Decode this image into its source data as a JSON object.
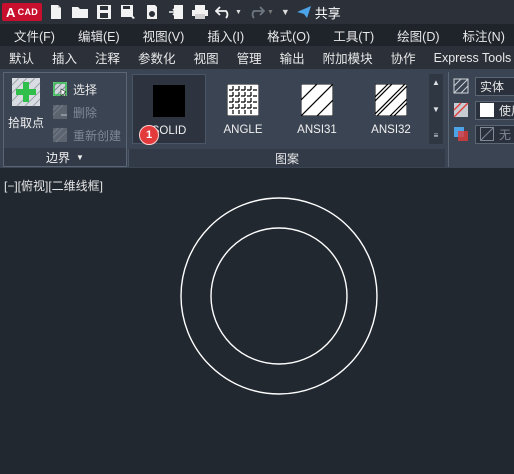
{
  "quick_access": {
    "logo_letter": "A",
    "logo_text": "CAD",
    "share_label": "共享",
    "icons": [
      "new-file-icon",
      "open-folder-icon",
      "save-icon",
      "save-as-icon",
      "publish-icon",
      "import-icon",
      "print-icon",
      "undo-icon",
      "redo-icon",
      "customize-dropdown-icon",
      "share-icon"
    ]
  },
  "menu": {
    "items": [
      "文件(F)",
      "编辑(E)",
      "视图(V)",
      "插入(I)",
      "格式(O)",
      "工具(T)",
      "绘图(D)",
      "标注(N)"
    ]
  },
  "ribbon_tabs": {
    "items": [
      "默认",
      "插入",
      "注释",
      "参数化",
      "视图",
      "管理",
      "输出",
      "附加模块",
      "协作",
      "Express Tools"
    ]
  },
  "boundary_panel": {
    "pick_points_label": "拾取点",
    "select_label": "选择",
    "remove_label": "删除",
    "recreate_label": "重新创建",
    "title": "边界"
  },
  "pattern_panel": {
    "title": "图案",
    "patterns": [
      {
        "name": "SOLID",
        "selected": true
      },
      {
        "name": "ANGLE",
        "selected": false
      },
      {
        "name": "ANSI31",
        "selected": false
      },
      {
        "name": "ANSI32",
        "selected": false
      }
    ],
    "badge": "1"
  },
  "properties_panel": {
    "hatch_type": "实体",
    "color_label": "使用",
    "transparency_label": "无"
  },
  "canvas": {
    "viewport_label": "[−][俯视][二维线框]"
  },
  "colors": {
    "background": "#212830",
    "ribbon": "#3b4453",
    "accent_red": "#c8102e",
    "badge_red": "#e33b3b",
    "circle_stroke": "#ffffff"
  }
}
